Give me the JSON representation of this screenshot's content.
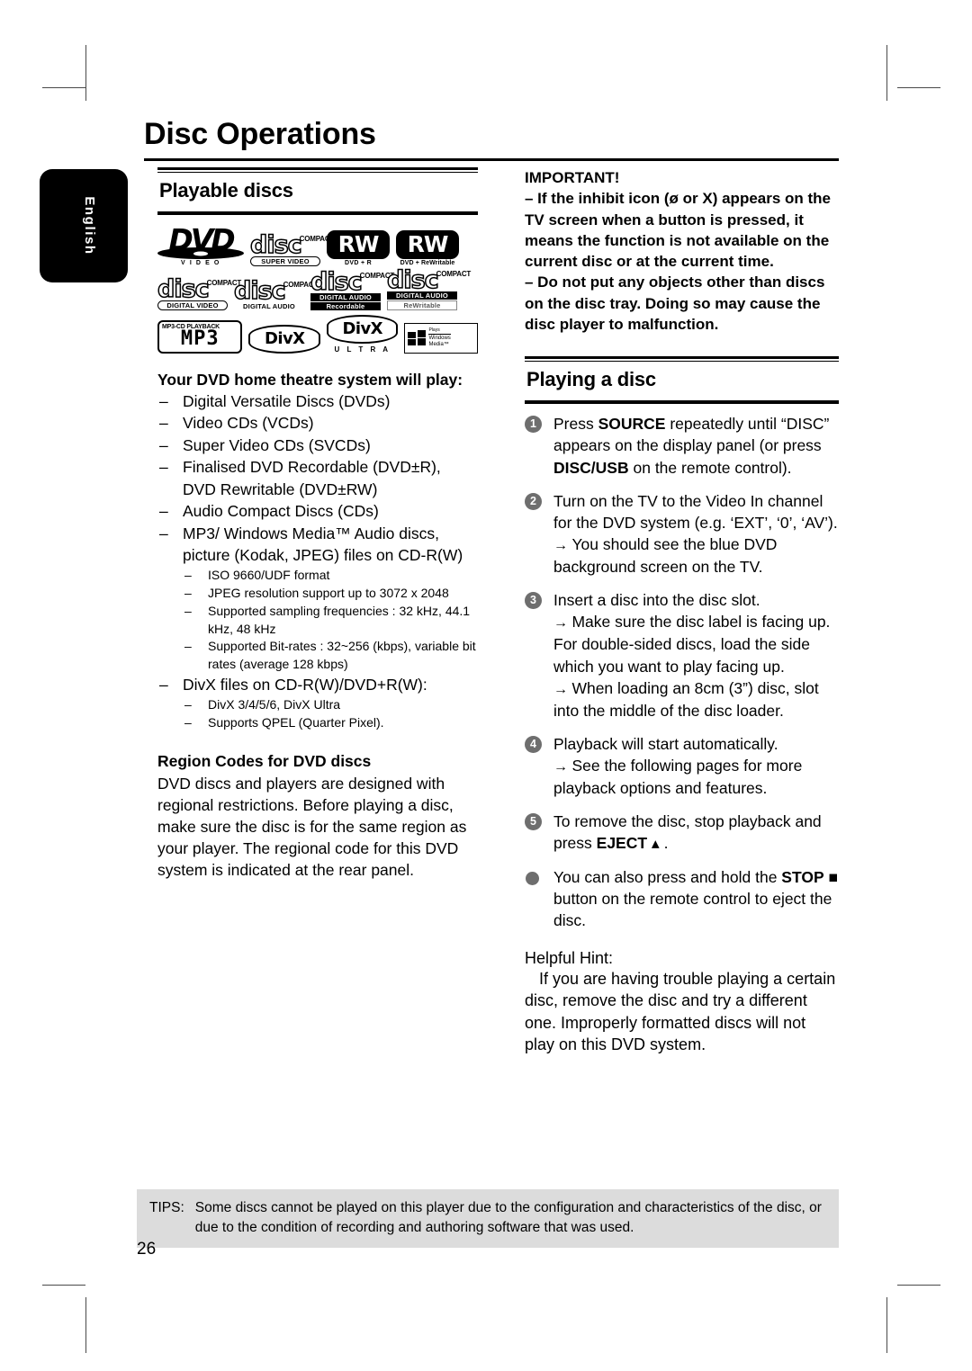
{
  "page": {
    "chapter_title": "Disc Operations",
    "language_tab": "English",
    "page_number": "26"
  },
  "left_column": {
    "section_title": "Playable discs",
    "logos": [
      [
        {
          "name": "dvd-video-logo",
          "word": "DVD",
          "caption": "V I D E O"
        },
        {
          "name": "compact-disc-super-video-logo",
          "top": "COMPACT",
          "word": "disc",
          "caption": "SUPER  VIDEO"
        },
        {
          "name": "dvd-plus-r-logo",
          "word": "RW",
          "caption": "DVD + R"
        },
        {
          "name": "dvd-plus-rewritable-logo",
          "word": "RW",
          "caption": "DVD + ReWritable"
        }
      ],
      [
        {
          "name": "compact-disc-digital-video-logo",
          "top": "COMPACT",
          "word": "disc",
          "caption": "DIGITAL VIDEO"
        },
        {
          "name": "compact-disc-digital-audio-logo",
          "top": "COMPACT",
          "word": "disc",
          "caption": "DIGITAL AUDIO"
        },
        {
          "name": "compact-disc-recordable-logo",
          "top": "COMPACT",
          "word": "disc",
          "caption": "DIGITAL AUDIO",
          "caption2": "Recordable"
        },
        {
          "name": "compact-disc-rewritable-logo",
          "top": "COMPACT",
          "word": "disc",
          "caption": "DIGITAL AUDIO",
          "caption2": "ReWritable"
        }
      ],
      [
        {
          "name": "mp3-cd-playback-logo",
          "top": "MP3-CD PLAYBACK",
          "word": "MP3"
        },
        {
          "name": "divx-logo",
          "word": "DivX"
        },
        {
          "name": "divx-ultra-logo",
          "word": "DivX",
          "caption": "U L T R A"
        },
        {
          "name": "windows-media-logo",
          "line1": "Plays",
          "line2": "Windows",
          "line3": "Media™"
        }
      ]
    ],
    "plays_heading": "Your DVD home theatre system will play:",
    "plays_list": [
      "Digital Versatile Discs (DVDs)",
      "Video CDs (VCDs)",
      "Super Video CDs (SVCDs)",
      "Finalised DVD Recordable (DVD±R), DVD Rewritable (DVD±RW)",
      "Audio Compact Discs (CDs)"
    ],
    "mp3_item": "MP3/ Windows Media™ Audio discs, picture (Kodak, JPEG) files on CD-R(W)",
    "mp3_sublist": [
      "ISO 9660/UDF format",
      "JPEG resolution support up to 3072 x 2048",
      "Supported sampling frequencies : 32 kHz, 44.1 kHz, 48 kHz",
      "Supported Bit-rates : 32~256 (kbps), variable bit rates (average 128 kbps)"
    ],
    "divx_item": "DivX files on CD-R(W)/DVD+R(W):",
    "divx_sublist": [
      "DivX 3/4/5/6, DivX Ultra",
      "Supports QPEL (Quarter Pixel)."
    ],
    "region_heading": "Region Codes for DVD discs",
    "region_body": "DVD discs and players are designed with regional restrictions. Before playing a disc, make sure the disc is for the same region as your player.  The regional code for this DVD system is indicated at the rear panel."
  },
  "right_column": {
    "important_title": "IMPORTANT!",
    "important_items": [
      "– If the inhibit icon (ø or X) appears on the TV screen when a button is pressed, it means the function is not available on the current disc or at the current time.",
      "– Do not put any objects other than discs on the disc tray.  Doing so may cause the disc player to malfunction."
    ],
    "section_title": "Playing a disc",
    "steps": [
      {
        "num": "1",
        "parts": [
          {
            "t": "Press ",
            "b": false
          },
          {
            "t": "SOURCE",
            "b": true
          },
          {
            "t": " repeatedly until “DISC” appears on the display panel (or press ",
            "b": false
          },
          {
            "t": "DISC/USB",
            "b": true
          },
          {
            "t": " on the remote control).",
            "b": false
          }
        ]
      },
      {
        "num": "2",
        "parts": [
          {
            "t": "Turn on the TV to the Video In channel for the DVD system (e.g. ‘EXT’, ‘0’, ‘AV’).",
            "b": false
          }
        ],
        "arrows": [
          "You should see the blue DVD background screen on the TV."
        ]
      },
      {
        "num": "3",
        "parts": [
          {
            "t": "Insert a disc into the disc slot.",
            "b": false
          }
        ],
        "arrows": [
          "Make sure the disc label is facing up. For double-sided discs, load the side which you want to play facing up.",
          "When loading an 8cm (3”) disc, slot into the middle of the disc loader."
        ]
      },
      {
        "num": "4",
        "parts": [
          {
            "t": "Playback will start automatically.",
            "b": false
          }
        ],
        "arrows": [
          "See the following pages for more playback options and features."
        ]
      },
      {
        "num": "5",
        "parts": [
          {
            "t": "To remove the disc, stop playback and press ",
            "b": false
          },
          {
            "t": "EJECT",
            "b": true
          },
          {
            "t": " ▴ .",
            "b": false
          }
        ]
      }
    ],
    "bullet_note_parts": [
      {
        "t": "You can also press and hold the ",
        "b": false
      },
      {
        "t": "STOP",
        "b": true
      },
      {
        "t": " ■ button on the remote control to eject the disc.",
        "b": false
      }
    ],
    "hint_title": "Helpful Hint:",
    "hint_body": "If you are having trouble playing a certain disc, remove the disc and try a different one. Improperly formatted discs will not play on this DVD system."
  },
  "footer": {
    "tips_label": "TIPS:",
    "tips_text": "Some discs cannot be played on this player due to the configuration and characteristics of the disc, or due to the condition of recording and authoring software that was used."
  },
  "colors": {
    "tips_background": "#dcdcdc",
    "step_badge": "#6e6e6e",
    "tab_background": "#000000"
  }
}
